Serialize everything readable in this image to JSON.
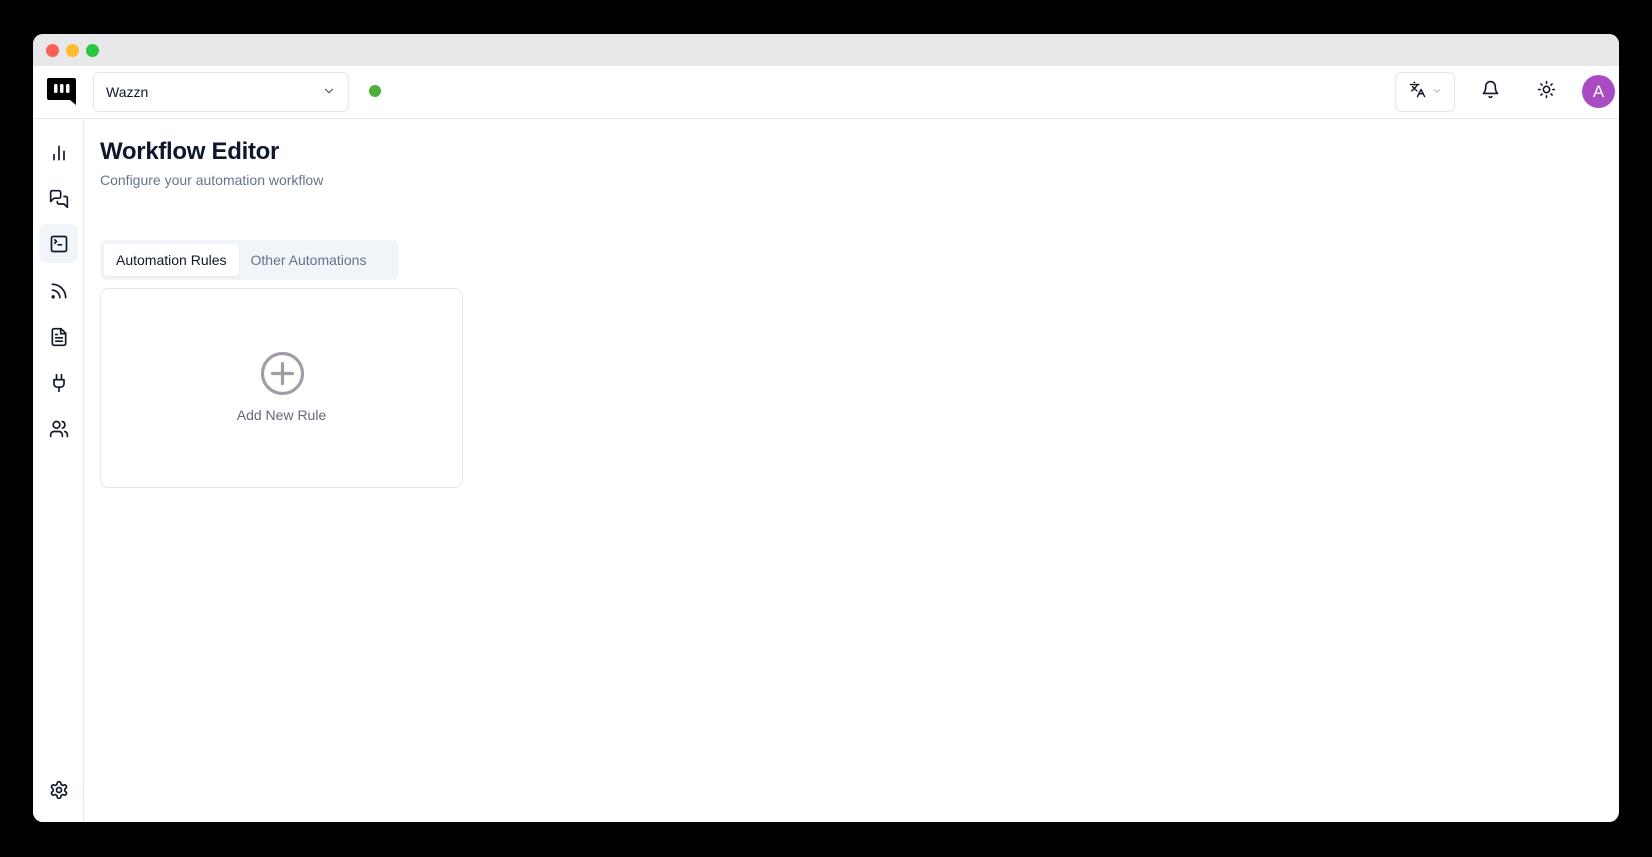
{
  "app": {
    "workspace": "Wazzn",
    "avatar_initial": "A"
  },
  "colors": {
    "accent": "#a94cc4",
    "status": "#4caf3a"
  },
  "sidebar": {
    "items": [
      {
        "icon": "bar-chart-icon"
      },
      {
        "icon": "messages-icon"
      },
      {
        "icon": "terminal-icon",
        "active": true
      },
      {
        "icon": "rss-icon"
      },
      {
        "icon": "document-icon"
      },
      {
        "icon": "plug-icon"
      },
      {
        "icon": "users-icon"
      },
      {
        "icon": "gear-icon"
      }
    ]
  },
  "page": {
    "title": "Workflow Editor",
    "subtitle": "Configure your automation workflow"
  },
  "tabs": [
    {
      "label": "Automation Rules",
      "active": true
    },
    {
      "label": "Other Automations",
      "active": false
    }
  ],
  "add_card": {
    "label": "Add New Rule"
  }
}
